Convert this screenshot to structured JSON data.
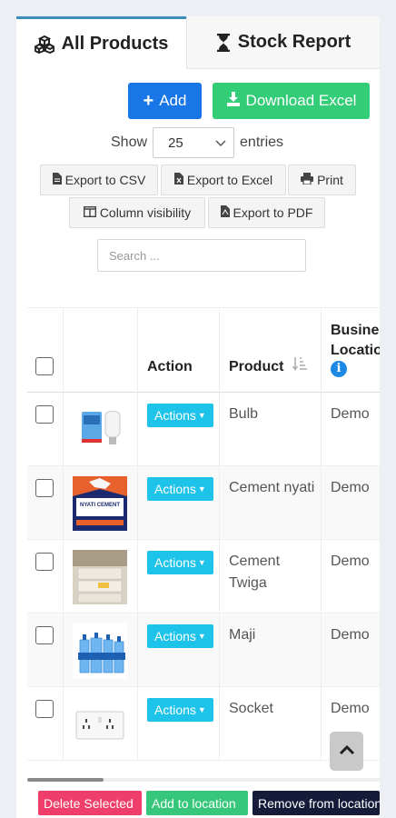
{
  "tabs": [
    {
      "label": "All Products",
      "icon": "cubes-icon"
    },
    {
      "label": "Stock Report",
      "icon": "hourglass-icon"
    }
  ],
  "toolbar": {
    "add_label": "Add",
    "download_label": "Download Excel"
  },
  "entries": {
    "show_label": "Show",
    "value": "25",
    "suffix": "entries"
  },
  "export_buttons": {
    "csv": "Export to CSV",
    "excel": "Export to Excel",
    "print": "Print",
    "columns": "Column visibility",
    "pdf": "Export to PDF"
  },
  "search": {
    "placeholder": "Search ..."
  },
  "table": {
    "headers": {
      "action": "Action",
      "product": "Product",
      "business_location": "Business Location"
    },
    "rows": [
      {
        "action": "Actions",
        "product": "Bulb",
        "location": "Demo",
        "image": "bulb"
      },
      {
        "action": "Actions",
        "product": "Cement nyati",
        "location": "Demo",
        "image": "cement-nyati",
        "image_text": "NYATI CEMENT"
      },
      {
        "action": "Actions",
        "product": "Cement Twiga",
        "location": "Demo",
        "image": "cement-twiga"
      },
      {
        "action": "Actions",
        "product": "Maji",
        "location": "Demo",
        "image": "water"
      },
      {
        "action": "Actions",
        "product": "Socket",
        "location": "Demo",
        "image": "socket"
      }
    ]
  },
  "bulk_actions": {
    "delete": "Delete Selected",
    "add_location": "Add to location",
    "remove_location": "Remove from location"
  },
  "colors": {
    "primary": "#1976e6",
    "success": "#33cc77",
    "info": "#1ec3ea",
    "danger": "#ef3e6a",
    "dark": "#161b3a"
  }
}
